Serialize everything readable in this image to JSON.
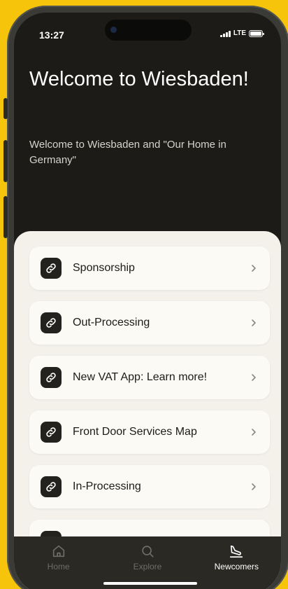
{
  "status_bar": {
    "time": "13:27",
    "network": "LTE"
  },
  "header": {
    "title": "Welcome to Wiesbaden!",
    "subtitle": "Welcome to Wiesbaden and \"Our Home in Germany\""
  },
  "list": {
    "items": [
      {
        "label": "Sponsorship",
        "icon": "link-icon"
      },
      {
        "label": "Out-Processing",
        "icon": "link-icon"
      },
      {
        "label": "New VAT App: Learn more!",
        "icon": "link-icon"
      },
      {
        "label": "Front Door Services Map",
        "icon": "link-icon"
      },
      {
        "label": "In-Processing",
        "icon": "link-icon"
      }
    ]
  },
  "tab_bar": {
    "tabs": [
      {
        "label": "Home",
        "icon": "house-icon",
        "active": false
      },
      {
        "label": "Explore",
        "icon": "search-icon",
        "active": false
      },
      {
        "label": "Newcomers",
        "icon": "plane-landing-icon",
        "active": true
      }
    ]
  },
  "colors": {
    "background": "#f6c40a",
    "screen_dark": "#1c1b17",
    "sheet": "#f3f1ea",
    "card": "#fcfaf4",
    "tab_bar": "#2a2924",
    "tab_active": "#ffffff",
    "tab_inactive": "#6f6d65"
  }
}
